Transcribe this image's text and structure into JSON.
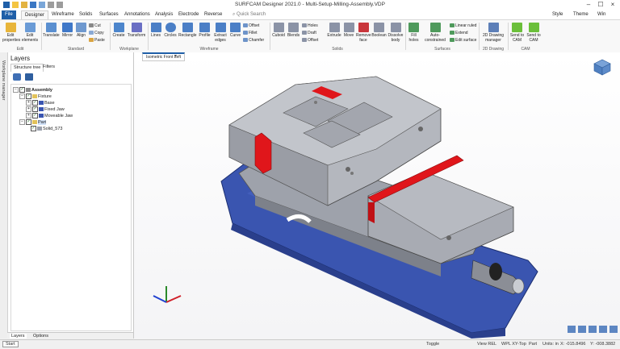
{
  "window": {
    "title": "SURFCAM Designer 2021.0 - Multi-Setup-Milling-Assembly.VDP"
  },
  "header_right": {
    "style_label": "Style",
    "theme_label": "Theme",
    "win_label": "Win"
  },
  "tabs": [
    "File",
    "Designer",
    "Wireframe",
    "Solids",
    "Surfaces",
    "Annotations",
    "Analysis",
    "Electrode",
    "Reverse"
  ],
  "search": {
    "placeholder": "Quick Search"
  },
  "ribbon": {
    "edit": {
      "label": "Edit",
      "buttons": [
        "Edit properties",
        "Edit elements"
      ]
    },
    "standard": {
      "label": "Standard",
      "buttons": [
        "Translate",
        "Mirror",
        "Align"
      ],
      "small": [
        "Cut",
        "Copy",
        "Paste"
      ]
    },
    "workplane": {
      "label": "Workplane",
      "buttons": [
        "Create",
        "Transform"
      ]
    },
    "wireframe": {
      "label": "Wireframe",
      "buttons": [
        "Lines",
        "Circles",
        "Rectangle",
        "Profile",
        "Extract edges",
        "Curve"
      ],
      "small": [
        "Offset",
        "Fillet",
        "Chamfer"
      ]
    },
    "solids": {
      "label": "Solids",
      "buttons": [
        "Cuboid",
        "Blends",
        "Extrude",
        "Move",
        "Remove face",
        "Boolean",
        "Dissolve body"
      ],
      "small": [
        "Holes",
        "Draft",
        "Offset"
      ]
    },
    "surfaces": {
      "label": "Surfaces",
      "buttons": [
        "Fill holes",
        "Auto-constrained"
      ],
      "small": [
        "Linear ruled",
        "Extend",
        "Edit surface"
      ]
    },
    "drawing2d": {
      "label": "2D Drawing",
      "buttons": [
        "2D Drawing manager"
      ]
    },
    "cam": {
      "label": "CAM",
      "buttons": [
        "Send to CAM",
        "Send to CAM"
      ]
    }
  },
  "side_strip": {
    "label": "Workplane manager"
  },
  "layers": {
    "title": "Layers",
    "subtabs": [
      "Structure tree",
      "Filters"
    ],
    "tree": [
      {
        "label": "Assembly",
        "level": 0
      },
      {
        "label": "Fixture",
        "level": 1
      },
      {
        "label": "Base",
        "level": 2
      },
      {
        "label": "Fixed Jaw",
        "level": 2
      },
      {
        "label": "Moveable Jaw",
        "level": 2
      },
      {
        "label": "Part",
        "level": 1
      },
      {
        "label": "Solid_573",
        "level": 2
      }
    ],
    "bottom_tabs": [
      "Layers",
      "Options"
    ]
  },
  "viewport": {
    "view_tab": "Isometric Front Left"
  },
  "status": {
    "start": "Start",
    "toggle": "Toggle",
    "view": "View REL",
    "wpl": "WPL XY-Top",
    "part": "Part",
    "units": "Units: in",
    "x": "X: -015.8496",
    "y": "Y: -008.3882"
  },
  "colors": {
    "accent": "#1f5fa8",
    "jaw": "#a9acb4",
    "base": "#3a55b0",
    "clamp": "#e0161b"
  }
}
